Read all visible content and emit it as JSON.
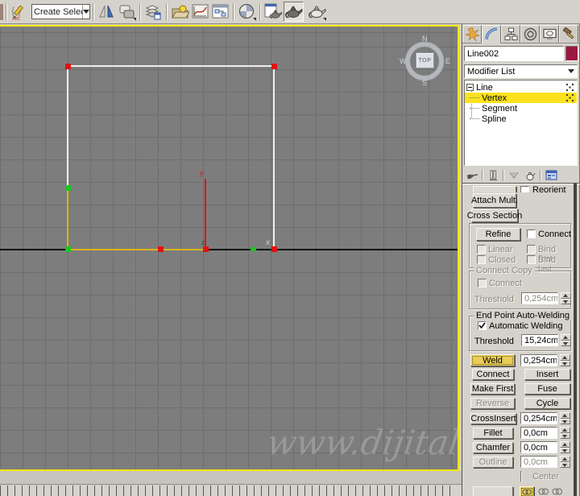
{
  "toolbar": {
    "selection_set_combo": "Create Selection Se",
    "icon_names": [
      "edit-named-selection-sets",
      "mirror",
      "align",
      "layer-manager",
      "light-lister",
      "curve-editor",
      "schematic-view",
      "material-editor",
      "render-setup",
      "render-production",
      "render-iterative"
    ],
    "abc_badge": "ABC"
  },
  "viewport": {
    "view_label": "TOP",
    "compass_n": "N",
    "compass_e": "E",
    "compass_s": "S",
    "compass_w": "W",
    "axis_x": "x",
    "axis_y": "y",
    "axis_z": "z",
    "watermark": "www.dijitalde"
  },
  "command_panel": {
    "tabs": [
      "create",
      "modify",
      "hierarchy",
      "motion",
      "display",
      "utilities"
    ],
    "active_tab": "modify",
    "object_name": "Line002",
    "object_color": "#9d1743",
    "modifier_list_label": "Modifier List",
    "modifier_stack": {
      "root": "Line",
      "children": [
        "Vertex",
        "Segment",
        "Spline"
      ],
      "selected": "Vertex"
    },
    "rollout": {
      "reorient": "Reorient",
      "attach_mult": "Attach Mult.",
      "cross_section": "Cross Section",
      "refine": "Refine",
      "connect_checkbox": "Connect",
      "linear": "Linear",
      "bind_first": "Bind first",
      "closed": "Closed",
      "bind_last": "Bind last",
      "connect_copy_title": "Connect Copy",
      "connect_copy_connect": "Connect",
      "connect_copy_threshold_label": "Threshold",
      "connect_copy_threshold_value": "0,254cm",
      "autoweld_title": "End Point Auto-Welding",
      "autoweld_checkbox": "Automatic Welding",
      "autoweld_threshold_label": "Threshold",
      "autoweld_threshold_value": "15,24cm",
      "weld": "Weld",
      "weld_value": "0,254cm",
      "connect_btn": "Connect",
      "insert_btn": "Insert",
      "make_first": "Make First",
      "fuse": "Fuse",
      "reverse": "Reverse",
      "cycle": "Cycle",
      "cross_insert": "CrossInsert",
      "cross_insert_value": "0,254cm",
      "fillet": "Fillet",
      "fillet_value": "0,0cm",
      "chamfer": "Chamfer",
      "chamfer_value": "0,0cm",
      "outline": "Outline",
      "outline_value": "0,0cm",
      "center": "Center"
    }
  },
  "colors": {
    "active_viewport_border": "#f1e90b",
    "selected_vertex": "#e01212",
    "soft_vertex": "#1ec41e",
    "selected_segment": "#dcb50e",
    "stack_highlight": "#fbe21c",
    "active_button": "#e9cd58",
    "object_color_swatch": "#9d1743",
    "viewport_background": "#7d7d7d"
  }
}
